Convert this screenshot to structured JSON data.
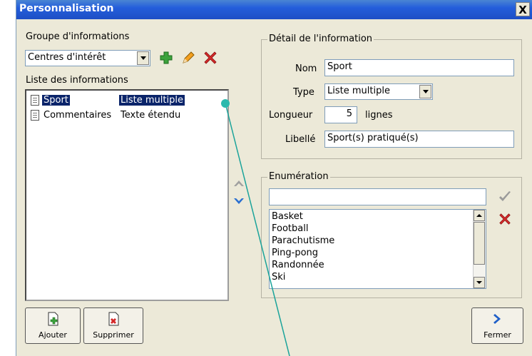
{
  "window": {
    "title": "Personnalisation",
    "close_label": "X"
  },
  "left": {
    "group_label": "Groupe d'informations",
    "group_value": "Centres d'intérêt",
    "list_label": "Liste des informations",
    "items": [
      {
        "name": "Sport",
        "type": "Liste multiple",
        "selected": true
      },
      {
        "name": "Commentaires",
        "type": "Texte étendu",
        "selected": false
      }
    ],
    "add_button": "Ajouter",
    "delete_button": "Supprimer"
  },
  "detail": {
    "legend": "Détail de l'information",
    "name_label": "Nom",
    "name_value": "Sport",
    "type_label": "Type",
    "type_value": "Liste multiple",
    "length_label": "Longueur",
    "length_value": "5",
    "length_unit": "lignes",
    "caption_label": "Libellé",
    "caption_value": "Sport(s) pratiqué(s)"
  },
  "enumeration": {
    "legend": "Enumération",
    "input_value": "",
    "items": [
      "Basket",
      "Football",
      "Parachutisme",
      "Ping-pong",
      "Randonnée",
      "Ski"
    ]
  },
  "close_button": "Fermer",
  "colors": {
    "title_bar": "#245edb",
    "selection": "#0a246a",
    "annotation": "#1aa39a"
  }
}
